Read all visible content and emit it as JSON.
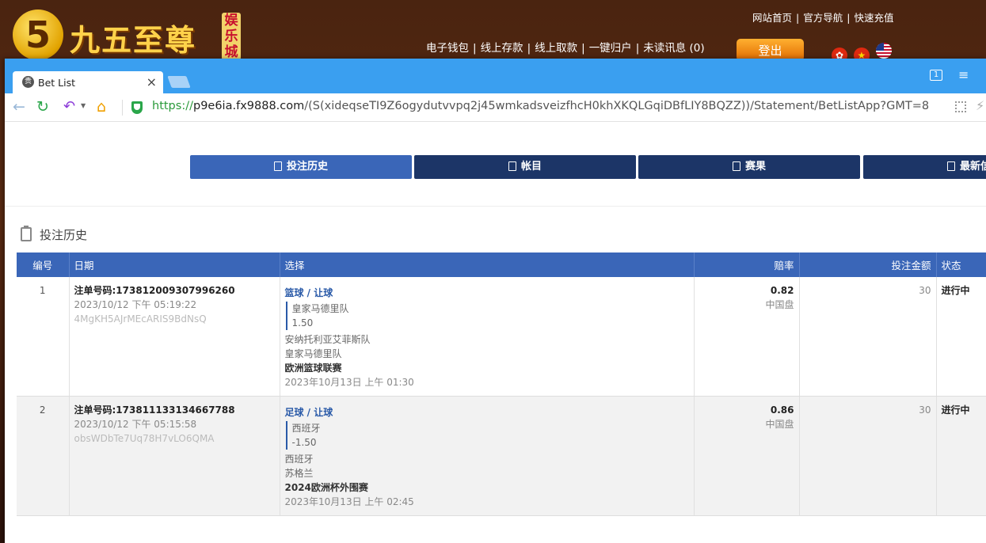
{
  "site": {
    "logo_digit": "5",
    "logo_text": "九五至尊",
    "logo_badge": "娱乐城",
    "top_links": [
      "网站首页",
      "官方导航",
      "快速充值"
    ],
    "nav": [
      "电子钱包",
      "线上存款",
      "线上取款",
      "一键归户",
      "未读讯息 (0)"
    ],
    "login_label": "登出"
  },
  "browser": {
    "tab_title": "Bet List",
    "tab_favicon": "贵",
    "window_badge": "1",
    "url_https": "https://",
    "url_host": "p9e6ia.fx9888.com",
    "url_path": "/(S(xideqseTI9Z6ogydutvvpq2j45wmkadsveizfhcH0khXKQLGqiDBfLIY8BQZZ))/Statement/BetListApp?GMT=8"
  },
  "page": {
    "tabs": [
      "投注历史",
      "帐目",
      "赛果",
      "最新信息"
    ],
    "section_title": "投注历史",
    "columns": [
      "编号",
      "日期",
      "选择",
      "赔率",
      "投注金额",
      "状态"
    ],
    "rows": [
      {
        "num": "1",
        "order": "注单号码:173812009307996260",
        "datetime": "2023/10/12 下午 05:19:22",
        "code": "4MgKH5AJrMEcARIS9BdNsQ",
        "sport": "篮球 / 让球",
        "pick_team": "皇家马德里队",
        "pick_hdp": "1.50",
        "home": "安纳托利亚艾菲斯队",
        "away": "皇家马德里队",
        "league": "欧洲篮球联赛",
        "match_time": "2023年10月13日 上午 01:30",
        "odds": "0.82",
        "odds_type": "中国盘",
        "stake": "30",
        "status": "进行中"
      },
      {
        "num": "2",
        "order": "注单号码:173811133134667788",
        "datetime": "2023/10/12 下午 05:15:58",
        "code": "obsWDbTe7Uq78H7vLO6QMA",
        "sport": "足球 / 让球",
        "pick_team": "西班牙",
        "pick_hdp": "-1.50",
        "home": "西班牙",
        "away": "苏格兰",
        "league": "2024欧洲杯外围赛",
        "match_time": "2023年10月13日 上午 02:45",
        "odds": "0.86",
        "odds_type": "中国盘",
        "stake": "30",
        "status": "进行中"
      }
    ]
  }
}
